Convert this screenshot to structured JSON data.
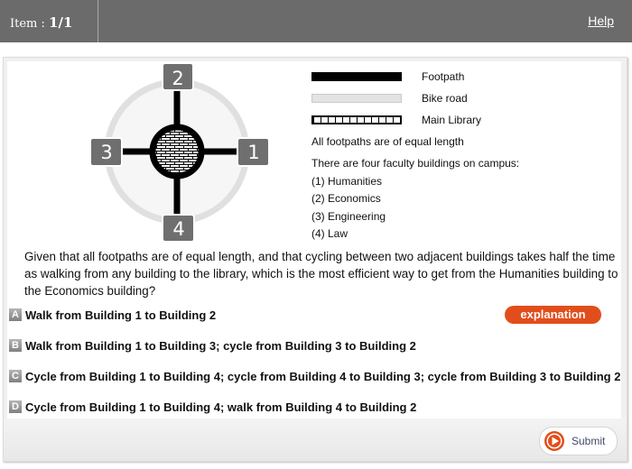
{
  "header": {
    "item_prefix": "Item :",
    "item_counter": "1/1",
    "help_link": "Help"
  },
  "diagram": {
    "buildings": [
      {
        "number": "1",
        "position": "right"
      },
      {
        "number": "2",
        "position": "top"
      },
      {
        "number": "3",
        "position": "left"
      },
      {
        "number": "4",
        "position": "bottom"
      }
    ],
    "colors": {
      "footpath": "#000000",
      "bike_road": "#e0e0e0",
      "building_box": "#6f6f6f",
      "building_label": "#ffffff"
    }
  },
  "legend": {
    "items": [
      {
        "label": "Footpath",
        "swatch": "footpath"
      },
      {
        "label": "Bike road",
        "swatch": "bike-road"
      },
      {
        "label": "Main Library",
        "swatch": "main-library"
      }
    ],
    "note": "All footpaths are of equal length",
    "buildings_intro": "There are four faculty buildings on campus:",
    "buildings": [
      "(1) Humanities",
      "(2) Economics",
      "(3) Engineering",
      "(4) Law"
    ]
  },
  "question": {
    "text": "Given that all footpaths are of equal length, and that cycling between two adjacent buildings takes half the time as walking from any building to the library, which is the most efficient way to get from the Humanities building to the Economics building?"
  },
  "options": [
    {
      "letter": "A",
      "text": "Walk from Building 1 to Building 2"
    },
    {
      "letter": "B",
      "text": "Walk from Building 1 to Building 3; cycle from Building 3 to Building 2"
    },
    {
      "letter": "C",
      "text": "Cycle from Building 1 to Building 4; cycle from Building 4 to Building 3; cycle from Building 3 to Building 2"
    },
    {
      "letter": "D",
      "text": "Cycle from Building 1 to Building 4; walk from Building 4 to Building 2"
    }
  ],
  "buttons": {
    "explanation": "explanation",
    "submit": "Submit"
  },
  "colors": {
    "topbar": "#6b6b6b",
    "accent": "#e24e1b"
  }
}
